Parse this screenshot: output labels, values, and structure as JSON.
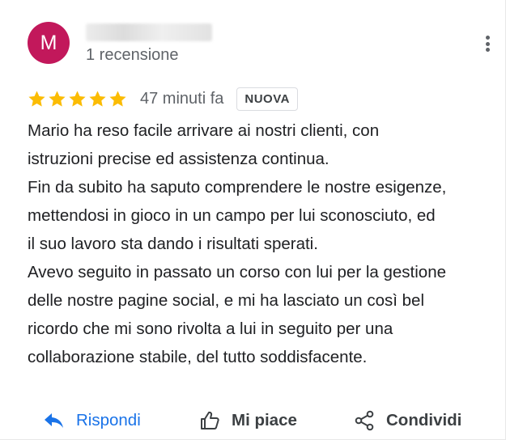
{
  "reviewer": {
    "avatar_letter": "M",
    "avatar_color": "#c2185b",
    "review_count": "1 recensione"
  },
  "review": {
    "rating": 5,
    "star_color": "#fbbc04",
    "time_ago": "47 minuti fa",
    "badge": "NUOVA",
    "lines": [
      "Mario ha reso facile arrivare ai nostri clienti, con",
      "istruzioni precise ed assistenza continua.",
      "Fin da subito ha saputo comprendere le nostre esigenze,",
      "mettendosi in gioco in un campo per lui sconosciuto, ed",
      "il suo lavoro sta dando i risultati sperati.",
      "Avevo seguito in passato un corso con lui per la gestione",
      "delle nostre pagine social, e mi ha lasciato un così bel",
      "ricordo che mi sono rivolta a lui in seguito per una",
      "collaborazione stabile, del tutto soddisfacente."
    ]
  },
  "actions": {
    "reply_label": "Rispondi",
    "reply_icon": "reply-arrow-icon",
    "like_label": "Mi piace",
    "like_icon": "thumbs-up-icon",
    "share_label": "Condividi",
    "share_icon": "share-icon",
    "accent_color": "#1a73e8"
  },
  "menu": {
    "icon": "more-vert-icon"
  }
}
